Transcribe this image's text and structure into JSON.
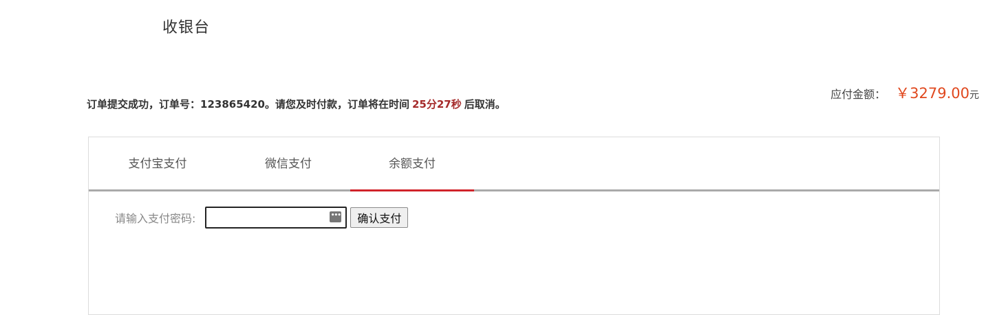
{
  "header": {
    "title": "收银台"
  },
  "order": {
    "prefix": "订单提交成功，订单号：",
    "order_no": "123865420",
    "middle": "。请您及时付款，订单将在时间",
    "countdown": "25分27秒",
    "suffix": "后取消。"
  },
  "amount": {
    "label": "应付金额：",
    "value": "￥3279.00",
    "unit": "元",
    "accent_color": "#e0481e"
  },
  "tabs": [
    {
      "label": "支付宝支付",
      "active": false
    },
    {
      "label": "微信支付",
      "active": false
    },
    {
      "label": "余额支付",
      "active": true
    }
  ],
  "pay_form": {
    "password_label": "请输入支付密码:",
    "password_value": "",
    "confirm_label": "确认支付",
    "key_icon": "password-key-icon"
  },
  "colors": {
    "active_tab_underline": "#d1232a",
    "countdown": "#a52a2a",
    "tab_border": "#a9a9a9"
  }
}
